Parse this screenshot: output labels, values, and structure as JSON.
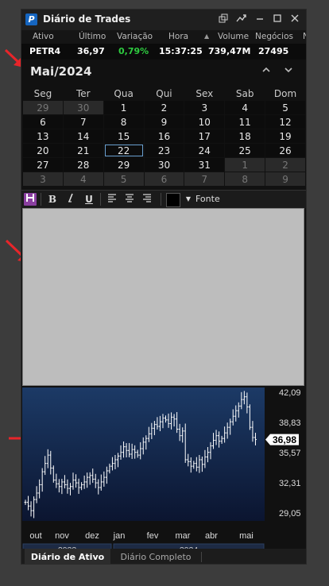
{
  "window": {
    "title": "Diário de Trades",
    "logo_letter": "P"
  },
  "quote": {
    "headers": [
      "Ativo",
      "Último",
      "Variação",
      "Hora",
      "Volume",
      "Negócios",
      "N"
    ],
    "symbol": "PETR4",
    "last": "36,97",
    "change": "0,79%",
    "time": "15:37:25",
    "volume": "739,47M",
    "trades": "27495",
    "change_color": "#2ecc40"
  },
  "calendar": {
    "month_label": "Mai/2024",
    "weekdays": [
      "Seg",
      "Ter",
      "Qua",
      "Qui",
      "Sex",
      "Sab",
      "Dom"
    ],
    "weeks": [
      [
        [
          "29",
          1
        ],
        [
          "30",
          1
        ],
        [
          "1",
          0
        ],
        [
          "2",
          0
        ],
        [
          "3",
          0
        ],
        [
          "4",
          0
        ],
        [
          "5",
          0
        ]
      ],
      [
        [
          "6",
          0
        ],
        [
          "7",
          0
        ],
        [
          "8",
          0
        ],
        [
          "9",
          0
        ],
        [
          "10",
          0
        ],
        [
          "11",
          0
        ],
        [
          "12",
          0
        ]
      ],
      [
        [
          "13",
          0
        ],
        [
          "14",
          0
        ],
        [
          "15",
          0
        ],
        [
          "16",
          0
        ],
        [
          "17",
          0
        ],
        [
          "18",
          0
        ],
        [
          "19",
          0
        ]
      ],
      [
        [
          "20",
          0
        ],
        [
          "21",
          0
        ],
        [
          "22",
          0
        ],
        [
          "23",
          0
        ],
        [
          "24",
          0
        ],
        [
          "25",
          0
        ],
        [
          "26",
          0
        ]
      ],
      [
        [
          "27",
          0
        ],
        [
          "28",
          0
        ],
        [
          "29",
          0
        ],
        [
          "30",
          0
        ],
        [
          "31",
          0
        ],
        [
          "1",
          1
        ],
        [
          "2",
          1
        ]
      ],
      [
        [
          "3",
          1
        ],
        [
          "4",
          1
        ],
        [
          "5",
          1
        ],
        [
          "6",
          1
        ],
        [
          "7",
          1
        ],
        [
          "8",
          1
        ],
        [
          "9",
          1
        ]
      ]
    ],
    "today": "22"
  },
  "editor_toolbar": {
    "font_label": "Fonte",
    "bold": "B",
    "underline": "U"
  },
  "chart_data": {
    "type": "bar",
    "subtype": "ohlc",
    "y_ticks": [
      "42,09",
      "38,83",
      "35,57",
      "32,31",
      "29,05"
    ],
    "ylim": [
      29.05,
      42.09
    ],
    "last_price_label": "36,98",
    "last_price": 36.98,
    "x_ticks": [
      "out",
      "nov",
      "dez",
      "jan",
      "fev",
      "mar",
      "abr",
      "mai"
    ],
    "years": [
      "2023",
      "2024"
    ],
    "closes": [
      30.2,
      29.8,
      29.3,
      30.5,
      31.2,
      32.1,
      33.5,
      34.4,
      35.3,
      33.9,
      32.6,
      32.2,
      31.9,
      32.4,
      32.1,
      31.7,
      31.9,
      32.6,
      32.3,
      31.8,
      32.1,
      32.4,
      32.9,
      33.1,
      32.7,
      32.3,
      31.8,
      32.4,
      32.9,
      33.6,
      34.1,
      34.4,
      34.8,
      35.2,
      35.6,
      36.2,
      35.8,
      35.4,
      35.9,
      35.6,
      35.3,
      36.0,
      36.7,
      37.1,
      37.6,
      38.2,
      38.6,
      38.4,
      38.9,
      39.3,
      39.1,
      38.7,
      39.4,
      39.2,
      38.1,
      37.4,
      37.9,
      34.8,
      34.6,
      34.1,
      34.4,
      34.0,
      34.8,
      34.3,
      35.1,
      35.6,
      36.3,
      36.9,
      37.4,
      36.8,
      37.1,
      37.7,
      38.3,
      38.9,
      39.5,
      40.1,
      40.6,
      41.3,
      41.6,
      40.5,
      38.3,
      37.2,
      36.98
    ],
    "volatility": 0.7
  },
  "tabs": [
    "Diário de Ativo",
    "Diário Completo"
  ],
  "colors": {
    "chart_bg_top": "#1c3a66",
    "chart_bg_bottom": "#0b1530",
    "bar_color": "#ffffff",
    "arrow_color": "#e8252a",
    "tab_accent": "#4a90d9"
  }
}
